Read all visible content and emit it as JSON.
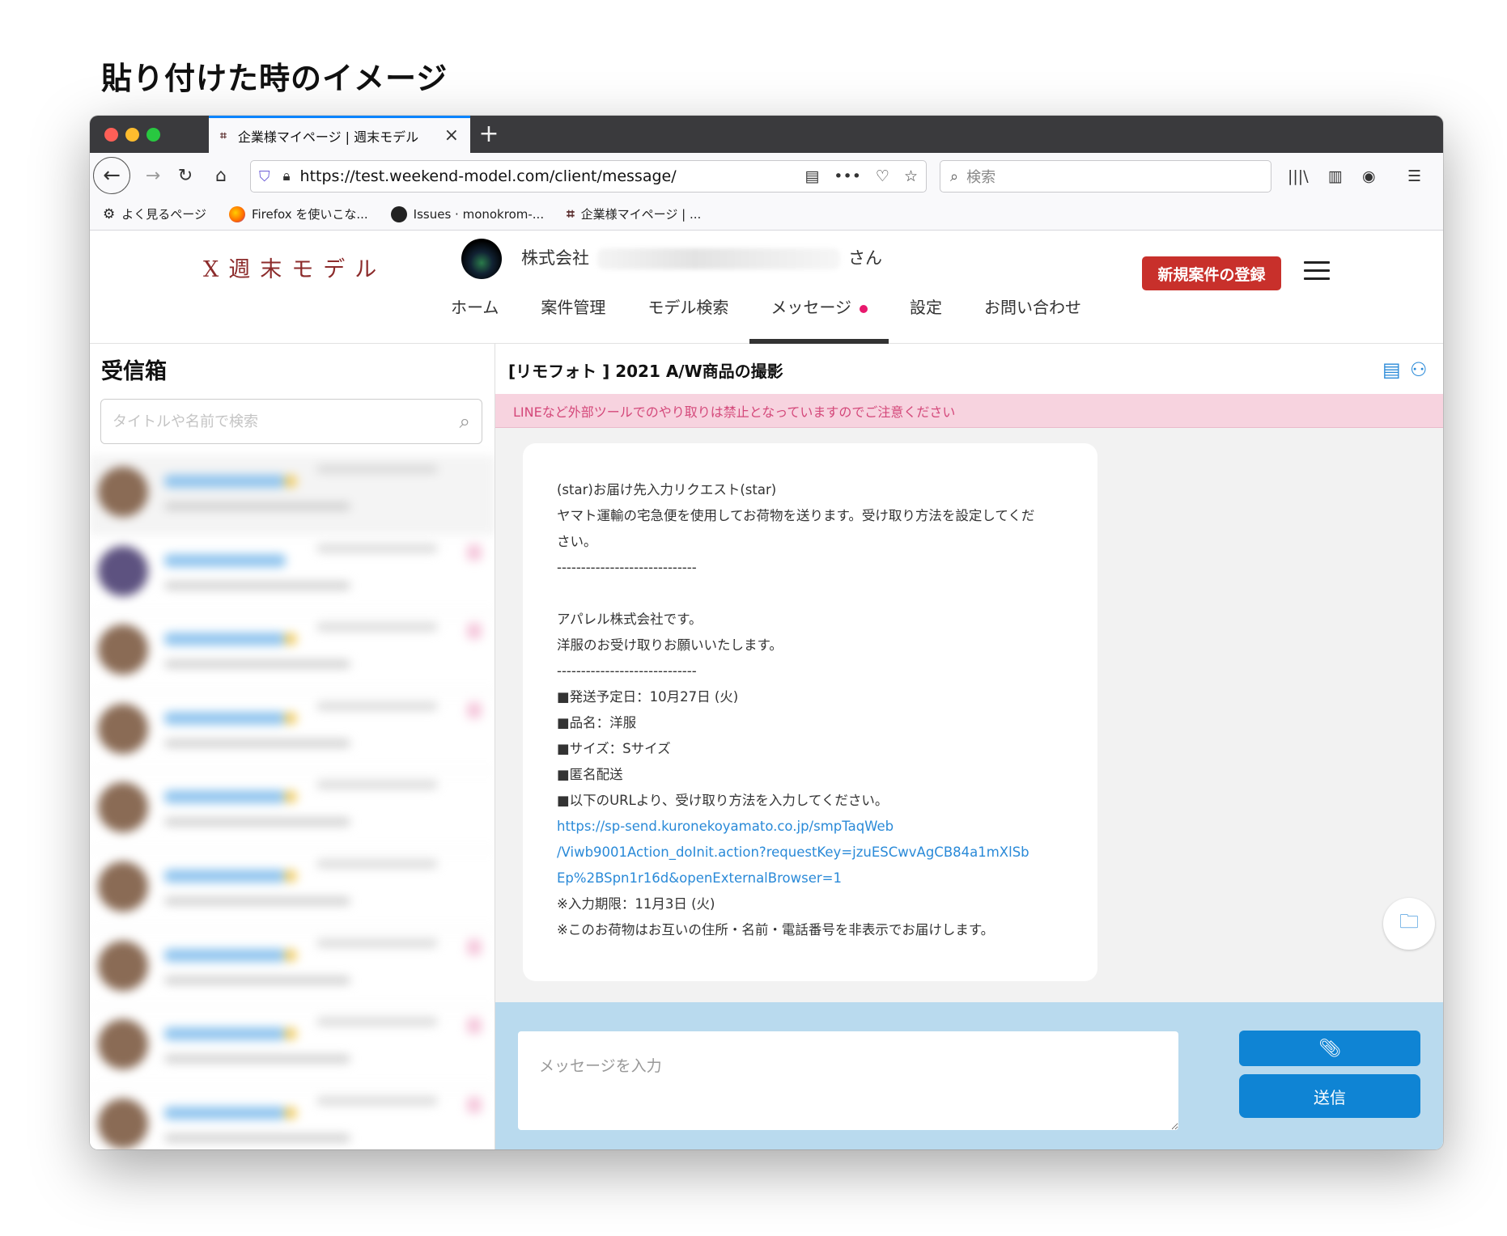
{
  "page_heading": "貼り付けた時のイメージ",
  "browser": {
    "tab_title": "企業様マイページ | 週末モデル",
    "tab_favicon": "⌗",
    "url": "https://test.weekend-model.com/client/message/",
    "search_placeholder": "検索",
    "bookmarks": [
      {
        "label": "よく見るページ",
        "icon": "gear-icon"
      },
      {
        "label": "Firefox を使いこな...",
        "icon": "firefox-icon"
      },
      {
        "label": "Issues · monokrom-...",
        "icon": "github-icon"
      },
      {
        "label": "企業様マイページ | ...",
        "icon": "site-favicon"
      }
    ]
  },
  "site": {
    "logo_text": "Ⅹ週末モデル",
    "company_prefix": "株式会社",
    "company_suffix": "さん",
    "new_project_button": "新規案件の登録",
    "nav": [
      {
        "label": "ホーム"
      },
      {
        "label": "案件管理"
      },
      {
        "label": "モデル検索"
      },
      {
        "label": "メッセージ",
        "active": true,
        "notification": true
      },
      {
        "label": "設定"
      },
      {
        "label": "お問い合わせ"
      }
    ],
    "accent_color": "#c8302b",
    "link_color": "#2a8ad8"
  },
  "inbox": {
    "title": "受信箱",
    "search_placeholder": "タイトルや名前で検索"
  },
  "conversation": {
    "title": "[リモフォト ] 2021 A/W商品の撮影",
    "warning": "LINEなど外部ツールでのやり取りは禁止となっていますのでご注意ください",
    "message_lines": [
      "(star)お届け先入力リクエスト(star)",
      "ヤマト運輸の宅急便を使用してお荷物を送ります。受け取り方法を設定してくだ",
      "さい。",
      "-----------------------------",
      "",
      "アパレル株式会社です。",
      "洋服のお受け取りお願いいたします。",
      "-----------------------------",
      "■発送予定日：10月27日 (火)",
      "■品名：洋服",
      "■サイズ：Sサイズ",
      "■匿名配送",
      "■以下のURLより、受け取り方法を入力してください。"
    ],
    "message_link_lines": [
      "https://sp-send.kuronekoyamato.co.jp/smpTaqWeb",
      "/Viwb9001Action_doInit.action?requestKey=jzuESCwvAgCB84a1mXlSb",
      "Ep%2BSpn1r16d&openExternalBrowser=1"
    ],
    "message_tail_lines": [
      "※入力期限：11月3日 (火)",
      "※このお荷物はお互いの住所・名前・電話番号を非表示でお届けします。"
    ],
    "composer_placeholder": "メッセージを入力",
    "send_button": "送信"
  }
}
